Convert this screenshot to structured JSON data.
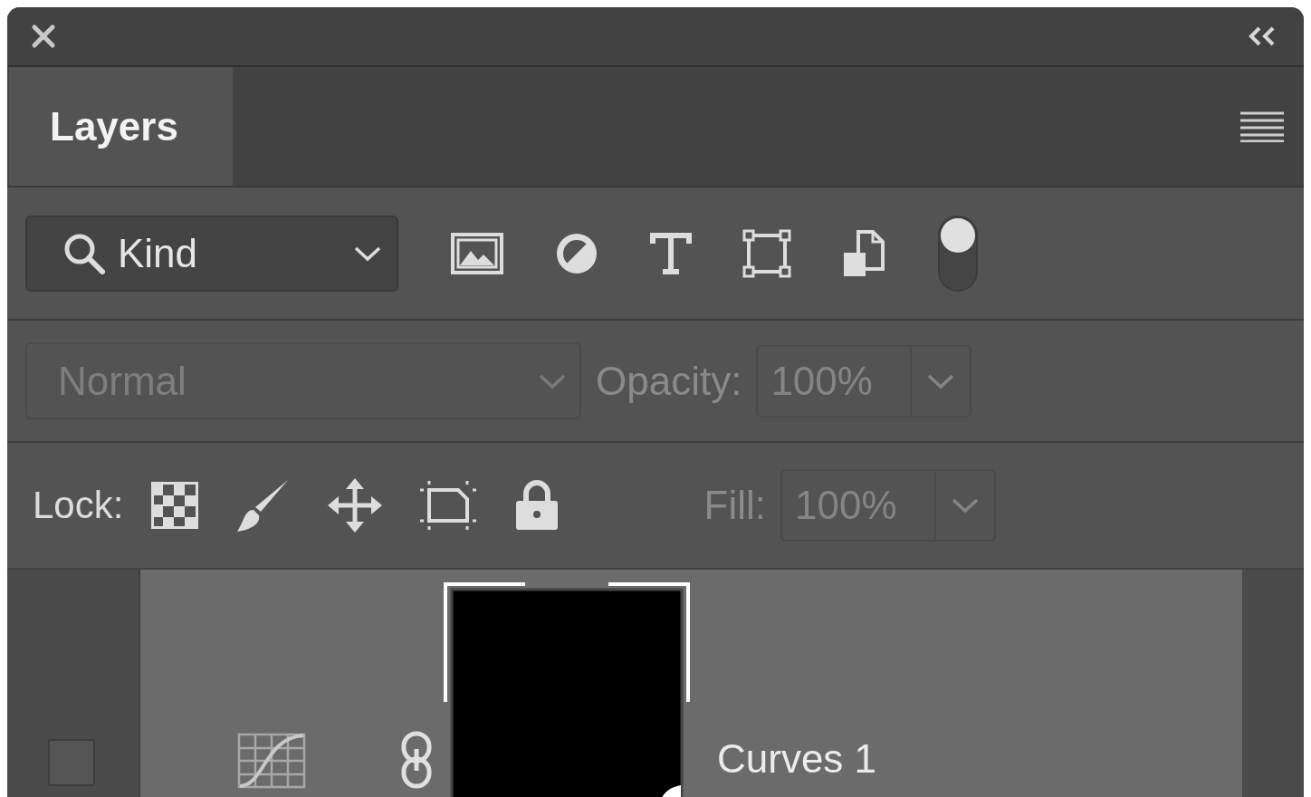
{
  "tabs": [
    {
      "label": "Layers",
      "selected": true
    }
  ],
  "filter": {
    "label": "Kind",
    "toggle_on": true
  },
  "blend_mode": {
    "value": "Normal",
    "disabled": true
  },
  "opacity": {
    "label": "Opacity:",
    "value": "100%",
    "disabled": true
  },
  "lock": {
    "label": "Lock:"
  },
  "fill": {
    "label": "Fill:",
    "value": "100%",
    "disabled": true
  },
  "layers": [
    {
      "name": "Curves 1",
      "kind": "curves",
      "visible": false,
      "selected": true
    }
  ]
}
